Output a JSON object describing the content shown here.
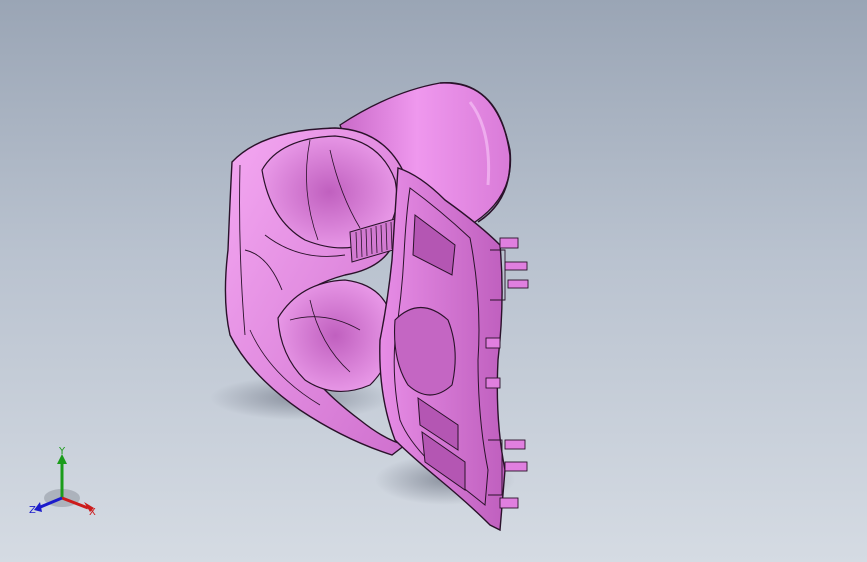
{
  "viewport": {
    "background_top": "#9aa5b5",
    "background_bottom": "#d5dbe3"
  },
  "model": {
    "color": "#e98ee8",
    "edge_color": "#2a122a"
  },
  "triad": {
    "x_label": "X",
    "y_label": "Y",
    "z_label": "Z",
    "x_color": "#cc1b1b",
    "y_color": "#1b9c1b",
    "z_color": "#1b1bcc"
  }
}
